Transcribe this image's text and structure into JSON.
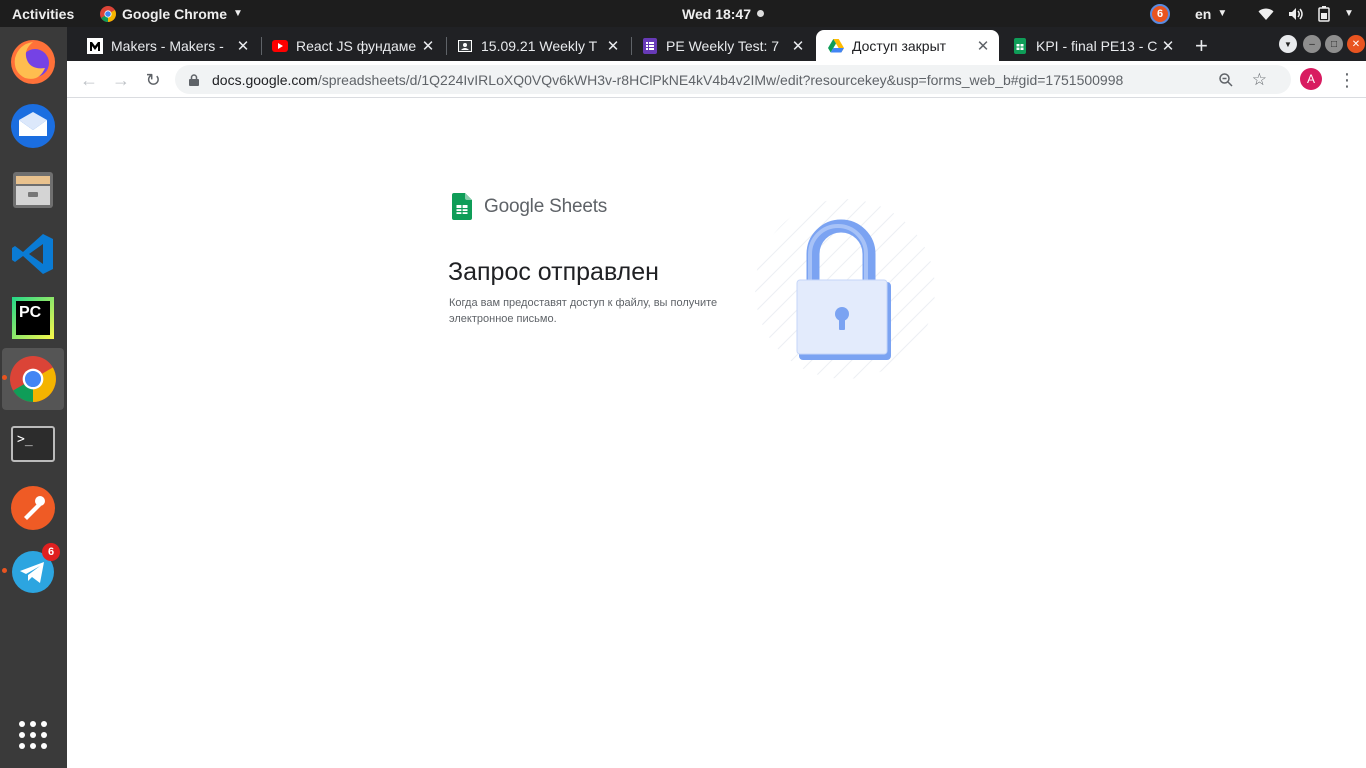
{
  "topbar": {
    "activities": "Activities",
    "app_name": "Google Chrome",
    "clock": "Wed 18:47",
    "notification_count": "6",
    "language": "en"
  },
  "dock": {
    "items": [
      {
        "name": "Firefox",
        "icon": "firefox-icon"
      },
      {
        "name": "Thunderbird",
        "icon": "thunderbird-icon"
      },
      {
        "name": "Files",
        "icon": "files-icon"
      },
      {
        "name": "Visual Studio Code",
        "icon": "vscode-icon"
      },
      {
        "name": "PyCharm",
        "icon": "pycharm-icon"
      },
      {
        "name": "Google Chrome",
        "icon": "chrome-icon"
      },
      {
        "name": "Terminal",
        "icon": "terminal-icon"
      },
      {
        "name": "Postman",
        "icon": "postman-icon"
      },
      {
        "name": "Telegram",
        "icon": "telegram-icon",
        "badge": "6"
      }
    ],
    "pycharm_label": "PC",
    "terminal_label": ">_"
  },
  "tabs": [
    {
      "title": "Makers - Makers -",
      "icon": "makers-icon"
    },
    {
      "title": "React JS фундаме",
      "icon": "youtube-icon"
    },
    {
      "title": "15.09.21 Weekly T",
      "icon": "classroom-icon"
    },
    {
      "title": "PE Weekly Test: 7",
      "icon": "forms-icon"
    },
    {
      "title": "Доступ закрыт",
      "icon": "drive-icon",
      "active": true
    },
    {
      "title": "KPI - final PE13 - C",
      "icon": "sheets-icon"
    }
  ],
  "toolbar": {
    "url_host": "docs.google.com",
    "url_path": "/spreadsheets/d/1Q224IvIRLoXQ0VQv6kWH3v-r8HClPkNE4kV4b4v2IMw/edit?resourcekey&usp=forms_web_b#gid=1751500998",
    "avatar_letter": "A"
  },
  "page": {
    "brand_name": "Google Sheets",
    "heading": "Запрос отправлен",
    "description": "Когда вам предоставят доступ к файлу, вы получите электронное письмо."
  },
  "colors": {
    "ubuntu_orange": "#e95420",
    "chrome_tab_bg": "#202124",
    "sheets_green": "#0f9d58",
    "lock_blue": "#7ba3f2"
  }
}
